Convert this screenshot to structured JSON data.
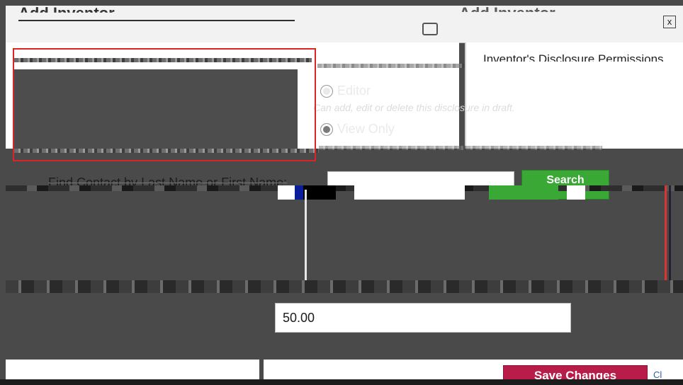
{
  "dialog": {
    "title": "Add Inventor",
    "ghost_title": "Add Inventor",
    "close_glyph": "x"
  },
  "permissions": {
    "heading": "Inventor's Disclosure Permissions",
    "options": [
      {
        "label": "Editor",
        "description": "Can add, edit or delete this disclosure in draft.",
        "checked": false
      },
      {
        "label": "View Only",
        "description": "",
        "checked": true
      }
    ]
  },
  "search": {
    "label": "Find Contact by Last Name or First Name:",
    "input_value": "",
    "button_label": "Search"
  },
  "percentage": {
    "value": "50.00"
  },
  "footer": {
    "save_label": "Save Changes",
    "close_label": "Cl"
  },
  "colors": {
    "highlight": "#d9252a",
    "search_button": "#3aa835",
    "save_button": "#b81d4a"
  },
  "icons": [
    "close-icon",
    "radio-icon"
  ]
}
